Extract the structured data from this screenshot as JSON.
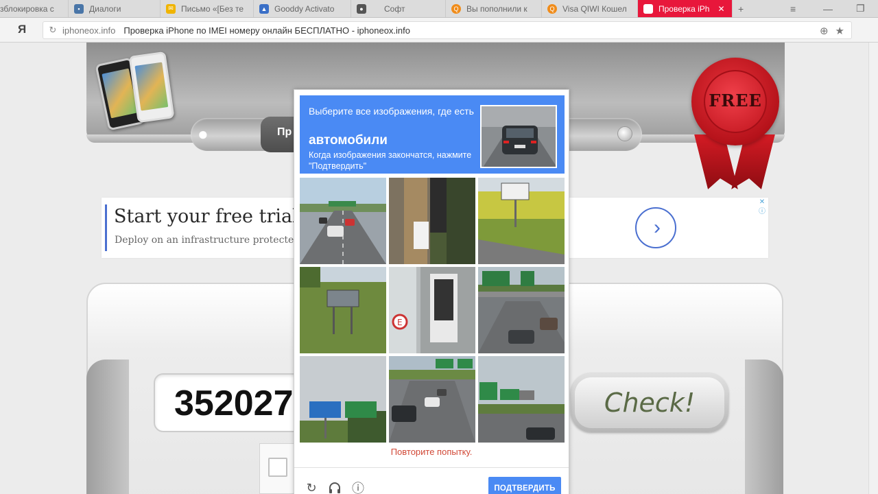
{
  "browser": {
    "tabs": [
      {
        "label": "зблокировка с",
        "icon": "",
        "color": "#dcdcdc"
      },
      {
        "label": "Диалоги",
        "icon": "chat-icon",
        "color": "#4a76a8"
      },
      {
        "label": "Письмо «[Без те",
        "icon": "mail-icon",
        "color": "#f0b400"
      },
      {
        "label": "Gooddy Activato",
        "icon": "app-icon",
        "color": "#3a6fc7"
      },
      {
        "label": "Софт",
        "icon": "apple-icon",
        "color": "#555555"
      },
      {
        "label": "Вы пополнили к",
        "icon": "qiwi-icon",
        "color": "#f08c1a"
      },
      {
        "label": "Visa QIWI Кошел",
        "icon": "qiwi-icon",
        "color": "#f08c1a"
      },
      {
        "label": "Проверка iPh",
        "icon": "page-icon",
        "color": "#e8173b",
        "active": true
      }
    ],
    "new_tab_symbol": "+",
    "menu_symbol": "≡",
    "minimize_symbol": "—",
    "restore_symbol": "❐",
    "yandex_logo": "Я",
    "reload_symbol": "↻",
    "url_host": "iphoneox.info",
    "page_title": "Проверка iPhone по IMEI номеру онлайн БЕСПЛАТНО - iphoneox.info"
  },
  "site": {
    "nav_partial": "Пр",
    "seal_text": "FREE",
    "ad": {
      "title": "Start your free trial",
      "subtitle": "Deploy on an infrastructure protected b",
      "arrow": "›"
    },
    "imei_value": "352027",
    "check_button": "Check!"
  },
  "captcha": {
    "instruction": "Выберите все изображения, где есть",
    "object": "автомобили",
    "instruction_tail": "Когда изображения закончатся, нажмите \"Подтвердить\"",
    "error": "Повторите попытку.",
    "verify_label": "ПОДТВЕРДИТЬ",
    "tiles": [
      {
        "name": "tile-highway-cars"
      },
      {
        "name": "tile-pole-paper"
      },
      {
        "name": "tile-road-sign-field"
      },
      {
        "name": "tile-sign-grass"
      },
      {
        "name": "tile-parking-sign"
      },
      {
        "name": "tile-highway-overpass"
      },
      {
        "name": "tile-green-signs-sky"
      },
      {
        "name": "tile-highway-traffic"
      },
      {
        "name": "tile-highway-signs"
      }
    ]
  },
  "colors": {
    "captcha_blue": "#4a8af4",
    "error_red": "#d14836",
    "active_tab": "#e8173b"
  }
}
